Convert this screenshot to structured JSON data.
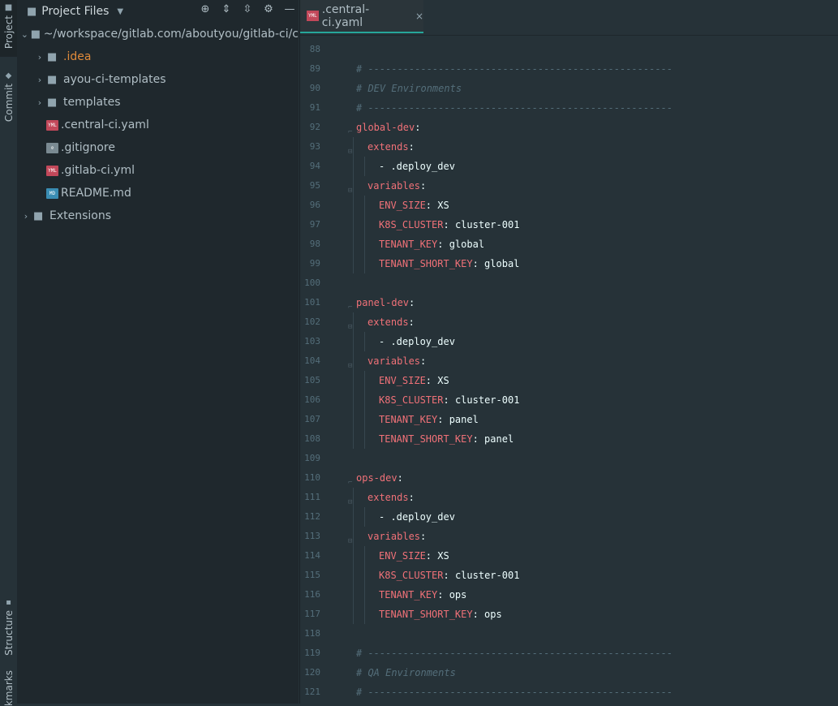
{
  "sidebar_strip": {
    "project_tab": "Project",
    "commit_tab": "Commit",
    "structure_tab": "Structure",
    "bookmarks_tab": "kmarks"
  },
  "project_panel": {
    "title": "Project Files",
    "root_path": "~/workspace/gitlab.com/aboutyou/gitlab-ci/c",
    "items": [
      {
        "label": ".idea",
        "type": "folder"
      },
      {
        "label": "ayou-ci-templates",
        "type": "folder"
      },
      {
        "label": "templates",
        "type": "folder"
      },
      {
        "label": ".central-ci.yaml",
        "type": "yml"
      },
      {
        "label": ".gitignore",
        "type": "git"
      },
      {
        "label": ".gitlab-ci.yml",
        "type": "yml"
      },
      {
        "label": "README.md",
        "type": "md"
      }
    ],
    "extensions": "Extensions"
  },
  "editor": {
    "tab_label": ".central-ci.yaml",
    "file_badge_yml": "YML",
    "file_badge_md": "MD",
    "close_glyph": "×",
    "lines": [
      {
        "n": "88",
        "indent": 0,
        "k": "",
        "v": "",
        "c": ""
      },
      {
        "n": "89",
        "indent": 0,
        "k": "",
        "v": "",
        "c": "# ----------------------------------------------------"
      },
      {
        "n": "90",
        "indent": 0,
        "k": "",
        "v": "",
        "c": "# DEV Environments"
      },
      {
        "n": "91",
        "indent": 0,
        "k": "",
        "v": "",
        "c": "# ----------------------------------------------------"
      },
      {
        "n": "92",
        "indent": 0,
        "k": "global-dev",
        "v": "",
        "c": ""
      },
      {
        "n": "93",
        "indent": 1,
        "k": "extends",
        "v": "",
        "c": ""
      },
      {
        "n": "94",
        "indent": 2,
        "k": "",
        "v": "- .deploy_dev",
        "c": ""
      },
      {
        "n": "95",
        "indent": 1,
        "k": "variables",
        "v": "",
        "c": ""
      },
      {
        "n": "96",
        "indent": 2,
        "k": "ENV_SIZE",
        "v": " XS",
        "c": ""
      },
      {
        "n": "97",
        "indent": 2,
        "k": "K8S_CLUSTER",
        "v": " cluster-001",
        "c": ""
      },
      {
        "n": "98",
        "indent": 2,
        "k": "TENANT_KEY",
        "v": " global",
        "c": ""
      },
      {
        "n": "99",
        "indent": 2,
        "k": "TENANT_SHORT_KEY",
        "v": " global",
        "c": ""
      },
      {
        "n": "100",
        "indent": 0,
        "k": "",
        "v": "",
        "c": ""
      },
      {
        "n": "101",
        "indent": 0,
        "k": "panel-dev",
        "v": "",
        "c": ""
      },
      {
        "n": "102",
        "indent": 1,
        "k": "extends",
        "v": "",
        "c": ""
      },
      {
        "n": "103",
        "indent": 2,
        "k": "",
        "v": "- .deploy_dev",
        "c": ""
      },
      {
        "n": "104",
        "indent": 1,
        "k": "variables",
        "v": "",
        "c": ""
      },
      {
        "n": "105",
        "indent": 2,
        "k": "ENV_SIZE",
        "v": " XS",
        "c": ""
      },
      {
        "n": "106",
        "indent": 2,
        "k": "K8S_CLUSTER",
        "v": " cluster-001",
        "c": ""
      },
      {
        "n": "107",
        "indent": 2,
        "k": "TENANT_KEY",
        "v": " panel",
        "c": ""
      },
      {
        "n": "108",
        "indent": 2,
        "k": "TENANT_SHORT_KEY",
        "v": " panel",
        "c": ""
      },
      {
        "n": "109",
        "indent": 0,
        "k": "",
        "v": "",
        "c": ""
      },
      {
        "n": "110",
        "indent": 0,
        "k": "ops-dev",
        "v": "",
        "c": ""
      },
      {
        "n": "111",
        "indent": 1,
        "k": "extends",
        "v": "",
        "c": ""
      },
      {
        "n": "112",
        "indent": 2,
        "k": "",
        "v": "- .deploy_dev",
        "c": ""
      },
      {
        "n": "113",
        "indent": 1,
        "k": "variables",
        "v": "",
        "c": ""
      },
      {
        "n": "114",
        "indent": 2,
        "k": "ENV_SIZE",
        "v": " XS",
        "c": ""
      },
      {
        "n": "115",
        "indent": 2,
        "k": "K8S_CLUSTER",
        "v": " cluster-001",
        "c": ""
      },
      {
        "n": "116",
        "indent": 2,
        "k": "TENANT_KEY",
        "v": " ops",
        "c": ""
      },
      {
        "n": "117",
        "indent": 2,
        "k": "TENANT_SHORT_KEY",
        "v": " ops",
        "c": ""
      },
      {
        "n": "118",
        "indent": 0,
        "k": "",
        "v": "",
        "c": ""
      },
      {
        "n": "119",
        "indent": 0,
        "k": "",
        "v": "",
        "c": "# ----------------------------------------------------"
      },
      {
        "n": "120",
        "indent": 0,
        "k": "",
        "v": "",
        "c": "# QA Environments"
      },
      {
        "n": "121",
        "indent": 0,
        "k": "",
        "v": "",
        "c": "# ----------------------------------------------------"
      }
    ]
  }
}
